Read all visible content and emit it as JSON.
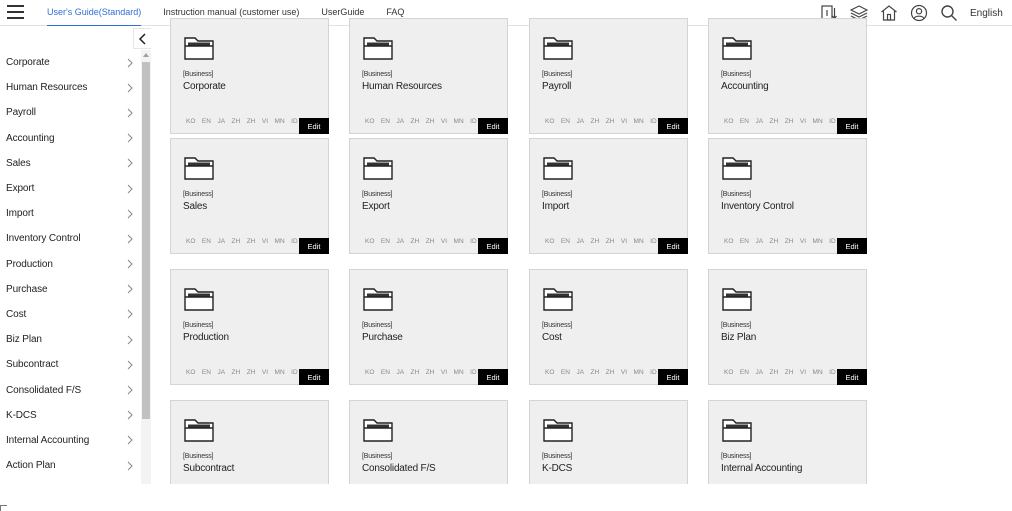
{
  "header": {
    "tabs": [
      {
        "label": "User's Guide(Standard)",
        "active": true
      },
      {
        "label": "Instruction manual (customer use)",
        "active": false
      },
      {
        "label": "UserGuide",
        "active": false
      },
      {
        "label": "FAQ",
        "active": false
      }
    ],
    "icons": [
      "manual-download-icon",
      "layers-icon",
      "home-icon",
      "user-icon",
      "search-icon"
    ],
    "language": "English",
    "accent_color": "#2f6fd6"
  },
  "sidebar": {
    "items": [
      {
        "label": "Corporate"
      },
      {
        "label": "Human Resources"
      },
      {
        "label": "Payroll"
      },
      {
        "label": "Accounting"
      },
      {
        "label": "Sales"
      },
      {
        "label": "Export"
      },
      {
        "label": "Import"
      },
      {
        "label": "Inventory Control"
      },
      {
        "label": "Production"
      },
      {
        "label": "Purchase"
      },
      {
        "label": "Cost"
      },
      {
        "label": "Biz Plan"
      },
      {
        "label": "Subcontract"
      },
      {
        "label": "Consolidated F/S"
      },
      {
        "label": "K-DCS"
      },
      {
        "label": "Internal Accounting"
      },
      {
        "label": "Action Plan"
      }
    ]
  },
  "cards": {
    "languages": [
      "KO",
      "EN",
      "JA",
      "ZH",
      "ZH",
      "VI",
      "MN",
      "ID"
    ],
    "edit_label": "Edit",
    "items": [
      {
        "category": "[Business]",
        "name": "Corporate"
      },
      {
        "category": "[Business]",
        "name": "Human Resources"
      },
      {
        "category": "[Business]",
        "name": "Payroll"
      },
      {
        "category": "[Business]",
        "name": "Accounting"
      },
      {
        "category": "[Business]",
        "name": "Sales"
      },
      {
        "category": "[Business]",
        "name": "Export"
      },
      {
        "category": "[Business]",
        "name": "Import"
      },
      {
        "category": "[Business]",
        "name": "Inventory Control"
      },
      {
        "category": "[Business]",
        "name": "Production"
      },
      {
        "category": "[Business]",
        "name": "Purchase"
      },
      {
        "category": "[Business]",
        "name": "Cost"
      },
      {
        "category": "[Business]",
        "name": "Biz Plan"
      },
      {
        "category": "[Business]",
        "name": "Subcontract"
      },
      {
        "category": "[Business]",
        "name": "Consolidated F/S"
      },
      {
        "category": "[Business]",
        "name": "K-DCS"
      },
      {
        "category": "[Business]",
        "name": "Internal Accounting"
      }
    ]
  }
}
